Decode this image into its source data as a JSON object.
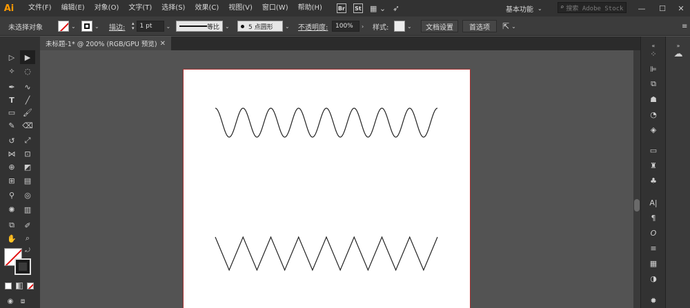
{
  "app": {
    "logo": "Ai",
    "menu": [
      "文件(F)",
      "编辑(E)",
      "对象(O)",
      "文字(T)",
      "选择(S)",
      "效果(C)",
      "视图(V)",
      "窗口(W)",
      "帮助(H)"
    ],
    "bridge_label": "Br",
    "stock_label": "St",
    "workspace": "基本功能",
    "stock_search_placeholder": "搜索 Adobe Stock",
    "win_min": "—",
    "win_max": "☐",
    "win_close": "✕"
  },
  "control": {
    "selection_state": "未选择对象",
    "stroke_label": "描边:",
    "stroke_weight": "1 pt",
    "stroke_profile": "等比",
    "brush_label": "5 点圆形",
    "opacity_label": "不透明度:",
    "opacity_value": "100%",
    "style_label": "样式:",
    "doc_setup": "文档设置",
    "preferences": "首选项"
  },
  "document": {
    "tab_title": "未标题-1* @ 200% (RGB/GPU 预览)",
    "tab_close": "✕"
  },
  "artwork": {
    "wave_color": "#222222",
    "zigzag_color": "#222222",
    "wave_cycles": 8,
    "zigzag_peaks": 8
  }
}
